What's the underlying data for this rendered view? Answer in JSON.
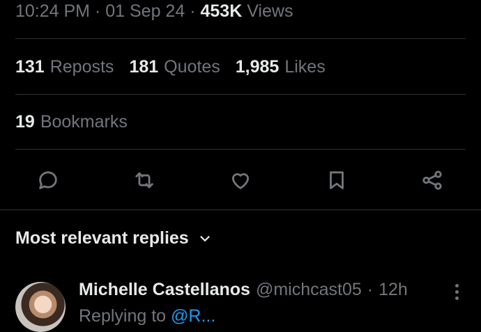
{
  "tweet_meta": {
    "time": "10:24 PM",
    "sep1": "·",
    "date": "01 Sep 24",
    "sep2": "·",
    "views_count": "453K",
    "views_label": "Views"
  },
  "stats": {
    "reposts_count": "131",
    "reposts_label": "Reposts",
    "quotes_count": "181",
    "quotes_label": "Quotes",
    "likes_count": "1,985",
    "likes_label": "Likes",
    "bookmarks_count": "19",
    "bookmarks_label": "Bookmarks"
  },
  "actions": {
    "icons": [
      "reply-icon",
      "repost-icon",
      "like-icon",
      "bookmark-icon",
      "share-icon"
    ]
  },
  "replies": {
    "sort_label": "Most relevant replies",
    "first": {
      "name": "Michelle Castellanos",
      "handle": "@michcast05",
      "dot": "·",
      "time": "12h",
      "replying_prefix": "Replying to",
      "replying_mention": "@R..."
    }
  },
  "colors": {
    "background": "#000000",
    "text_primary": "#e7e9ea",
    "text_secondary": "#71767b",
    "divider": "#2f3336",
    "link": "#1d9bf0"
  }
}
